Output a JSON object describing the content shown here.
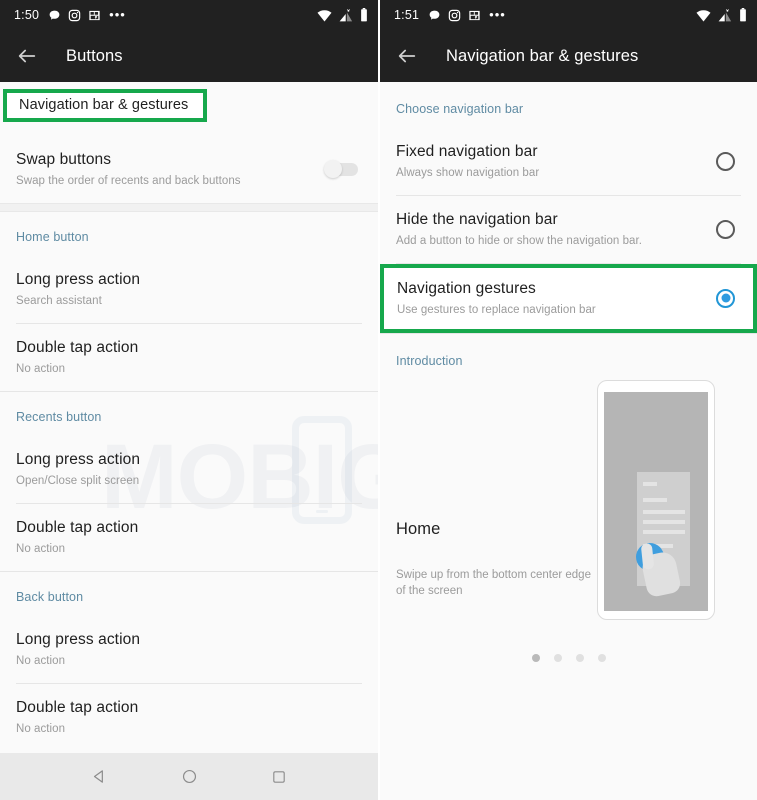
{
  "left_screen": {
    "status_bar": {
      "time": "1:50",
      "left_icons": [
        "chat-bubble-icon",
        "instagram-icon",
        "photo-calendar-icon",
        "more-notifications-icon"
      ],
      "right_icons": [
        "wifi-icon",
        "mobile-signal-off-icon",
        "battery-icon"
      ]
    },
    "app_bar": {
      "back_icon": "back-arrow-icon",
      "title": "Buttons"
    },
    "nav_link": {
      "label": "Navigation bar & gestures",
      "highlighted": true
    },
    "swap_row": {
      "title": "Swap buttons",
      "subtitle": "Swap the order of recents and back buttons",
      "toggle_state": "off"
    },
    "sections": [
      {
        "header": "Home button",
        "rows": [
          {
            "title": "Long press action",
            "subtitle": "Search assistant"
          },
          {
            "title": "Double tap action",
            "subtitle": "No action"
          }
        ]
      },
      {
        "header": "Recents button",
        "rows": [
          {
            "title": "Long press action",
            "subtitle": "Open/Close split screen"
          },
          {
            "title": "Double tap action",
            "subtitle": "No action"
          }
        ]
      },
      {
        "header": "Back button",
        "rows": [
          {
            "title": "Long press action",
            "subtitle": "No action"
          },
          {
            "title": "Double tap action",
            "subtitle": "No action"
          }
        ]
      }
    ],
    "nav_bar": {
      "back": "back-triangle-icon",
      "home": "home-circle-icon",
      "recents": "recents-square-icon"
    }
  },
  "right_screen": {
    "status_bar": {
      "time": "1:51",
      "left_icons": [
        "chat-bubble-icon",
        "instagram-icon",
        "photo-calendar-icon",
        "more-notifications-icon"
      ],
      "right_icons": [
        "wifi-icon",
        "mobile-signal-off-icon",
        "battery-icon"
      ]
    },
    "app_bar": {
      "back_icon": "back-arrow-icon",
      "title": "Navigation bar & gestures"
    },
    "choose_header": "Choose navigation bar",
    "options": [
      {
        "title": "Fixed navigation bar",
        "subtitle": "Always show navigation bar",
        "selected": false,
        "highlighted": false
      },
      {
        "title": "Hide the navigation bar",
        "subtitle": "Add a button to hide or show the navigation bar.",
        "selected": false,
        "highlighted": false
      },
      {
        "title": "Navigation gestures",
        "subtitle": "Use gestures to replace navigation bar",
        "selected": true,
        "highlighted": true
      }
    ],
    "introduction_header": "Introduction",
    "intro": {
      "title": "Home",
      "subtitle": "Swipe up from the bottom center edge of the screen"
    },
    "page_dots": {
      "count": 4,
      "active_index": 0
    }
  },
  "watermark": {
    "text": "MOBIGYAAN",
    "logo": "phone-outline-logo"
  },
  "colors": {
    "highlight_green": "#16a84c",
    "accent_blue": "#2e9be0",
    "section_header_blue": "#5f8ba3",
    "status_bar_dark": "#212121",
    "page_background": "#fafafa"
  }
}
